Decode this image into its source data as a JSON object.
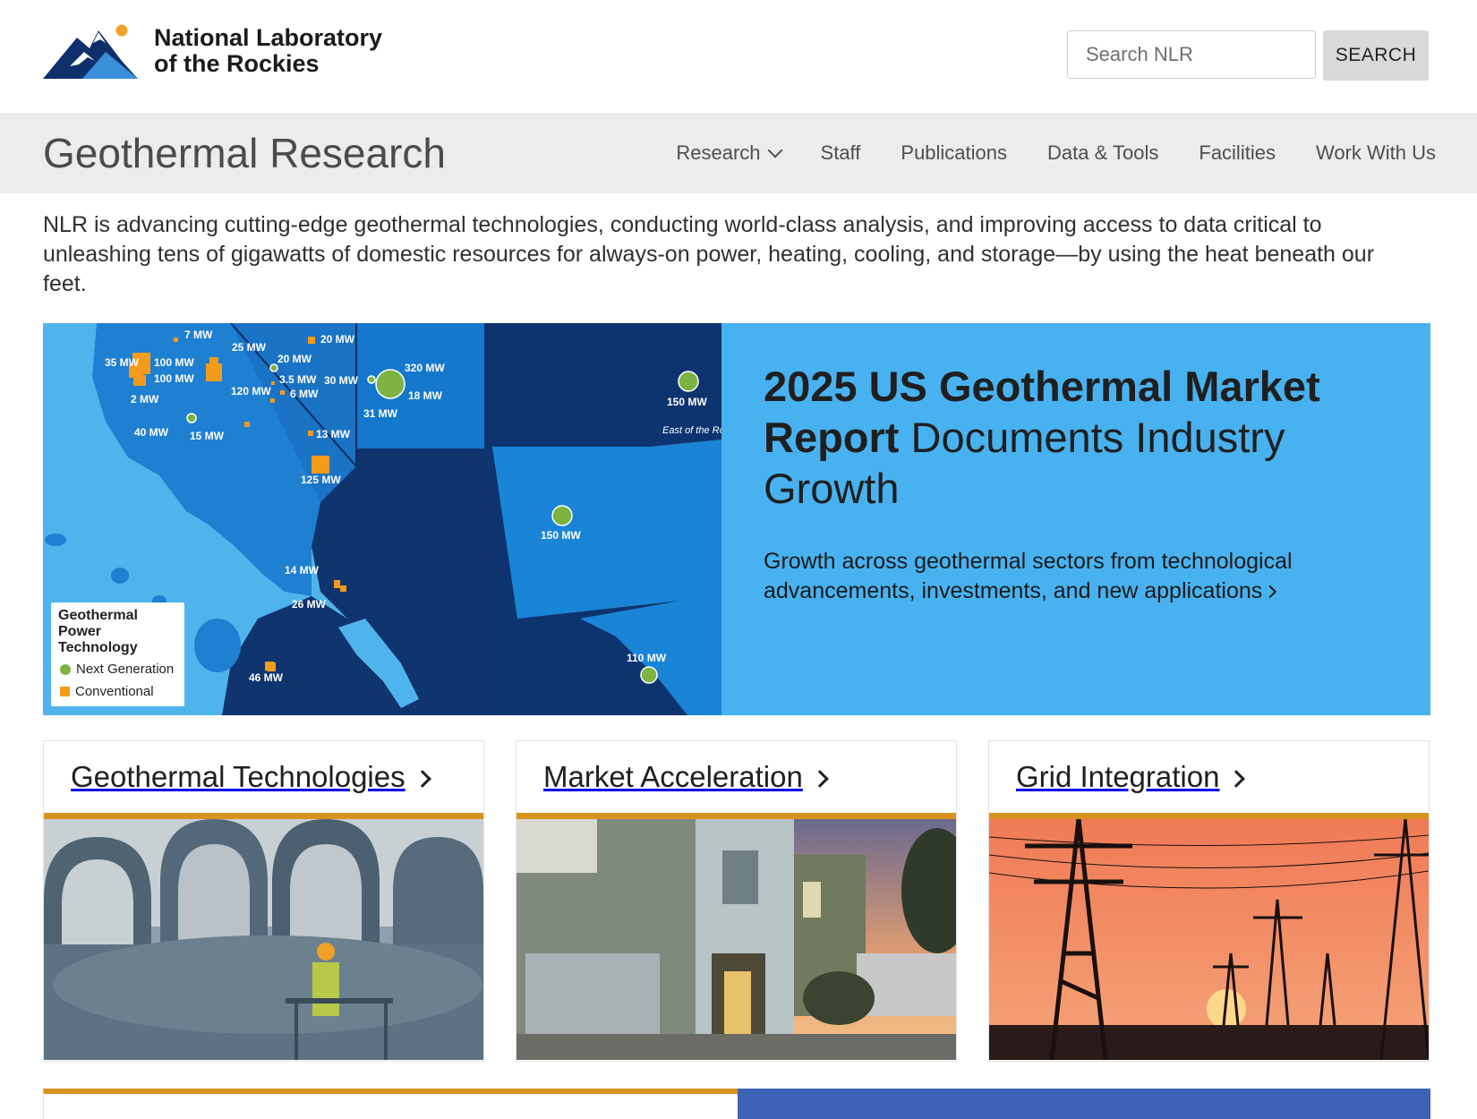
{
  "header": {
    "logo_line1": "National Laboratory",
    "logo_line2": "of the Rockies",
    "search_placeholder": "Search NLR",
    "search_button": "SEARCH"
  },
  "subnav": {
    "title": "Geothermal Research",
    "items": [
      "Research",
      "Staff",
      "Publications",
      "Data & Tools",
      "Facilities",
      "Work With Us"
    ]
  },
  "intro": "NLR is advancing cutting-edge geothermal technologies, conducting world-class analysis, and improving access to data critical to unleashing tens of gigawatts of domestic resources for always-on power, heating, cooling, and storage—by using the heat beneath our feet.",
  "hero": {
    "title_bold": "2025 US Geothermal Market Report",
    "title_rest": " Documents Industry Growth",
    "description": "Growth across geothermal sectors from technological advancements, investments, and new applications",
    "map": {
      "legend_title": "Geothermal Power Technology",
      "legend_next": "Next Generation",
      "legend_conventional": "Conventional",
      "labels": [
        "7 MW",
        "25 MW",
        "20 MW",
        "20 MW",
        "35 MW",
        "100 MW",
        "100 MW",
        "3.5 MW",
        "120 MW",
        "6 MW",
        "2 MW",
        "40 MW",
        "15 MW",
        "13 MW",
        "125 MW",
        "30 MW",
        "320 MW",
        "18 MW",
        "31 MW",
        "150 MW",
        "East of the Rockies",
        "150 MW",
        "14 MW",
        "26 MW",
        "46 MW",
        "110 MW"
      ]
    }
  },
  "cards": [
    {
      "title": "Geothermal Technologies"
    },
    {
      "title": "Market Acceleration"
    },
    {
      "title": "Grid Integration"
    }
  ],
  "colors": {
    "accent": "#d9921f",
    "hero_panel": "#48b2f0",
    "nav_bg": "#ececec"
  }
}
